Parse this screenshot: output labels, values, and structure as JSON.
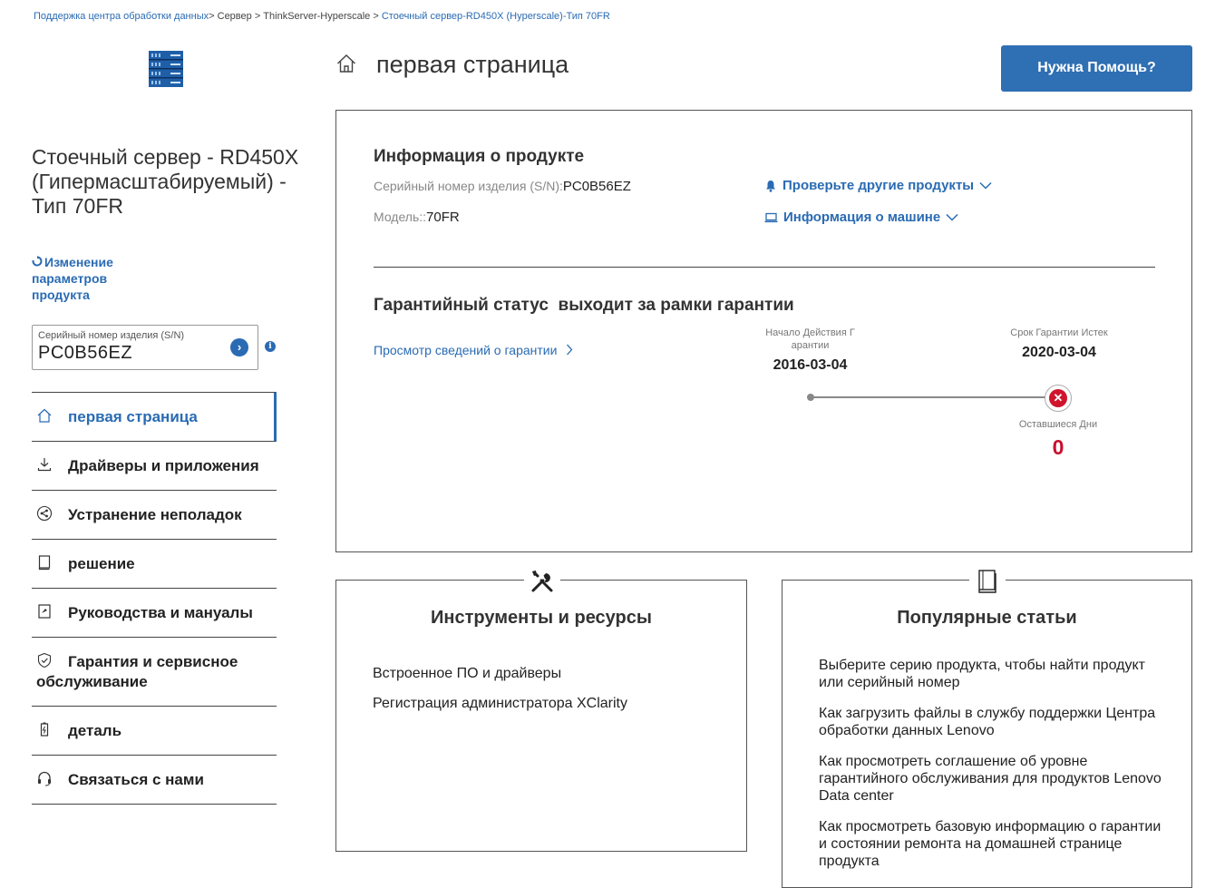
{
  "breadcrumb": {
    "item1": "Поддержка центра обработки данных",
    "sep1": ">",
    "item2": " Сервер ",
    "sep2": ">",
    "item3": " ThinkServer-Hyperscale ",
    "sep3": ">",
    "current": " Стоечный сервер-RD450X (Hyperscale)-Тип 70FR"
  },
  "sidebar": {
    "product_name": "Стоечный сервер - RD450X (Гипермасштабируемый) - Тип 70FR",
    "change_product": "Изменение параметров продукта",
    "serial_label": "Серийный номер изделия (S/N)",
    "serial_value": "PC0B56EZ",
    "go_icon": "›",
    "info_icon": "i",
    "nav": [
      {
        "label": "первая страница"
      },
      {
        "label": "Драйверы и приложения"
      },
      {
        "label": "Устранение неполадок"
      },
      {
        "label": "решение"
      },
      {
        "label": "Руководства и мануалы"
      },
      {
        "label": "Гарантия и сервисное обслуживание"
      },
      {
        "label": "деталь"
      },
      {
        "label": "Связаться с нами"
      }
    ]
  },
  "header": {
    "page_title": "первая страница",
    "help_button": "Нужна Помощь?"
  },
  "product_info": {
    "title": "Информация о продукте",
    "serial_label": "Серийный номер изделия (S/N):",
    "serial_value": "PC0B56EZ",
    "model_label": "Модель::",
    "model_value": "70FR",
    "check_other": "Проверьте другие продукты",
    "machine_info": "Информация о машине"
  },
  "warranty": {
    "title_prefix": "Гарантийный статус",
    "status": "выходит за рамки гарантии",
    "details_link": "Просмотр сведений о гарантии",
    "start_label": "Начало Действия Г арантии",
    "start_date": "2016-03-04",
    "end_label": "Срок Гарантии Истек",
    "end_date": "2020-03-04",
    "remaining_label": "Оставшиеся Дни",
    "remaining_days": "0",
    "expired_icon": "✕"
  },
  "tools": {
    "title": "Инструменты и ресурсы",
    "items": [
      "Встроенное ПО и драйверы",
      "Регистрация администратора XClarity"
    ]
  },
  "articles": {
    "title": "Популярные статьи",
    "items": [
      "Выберите серию продукта, чтобы найти продукт или серийный номер",
      "Как загрузить файлы в службу поддержки Центра обработки данных Lenovo",
      "Как просмотреть соглашение об уровне гарантийного обслуживания для продуктов Lenovo Data center",
      "Как просмотреть базовую информацию о гарантии и состоянии ремонта на домашней странице продукта"
    ]
  },
  "colors": {
    "accent": "#2a6bb3",
    "button": "#2f6fb3",
    "expired": "#c8102e"
  }
}
